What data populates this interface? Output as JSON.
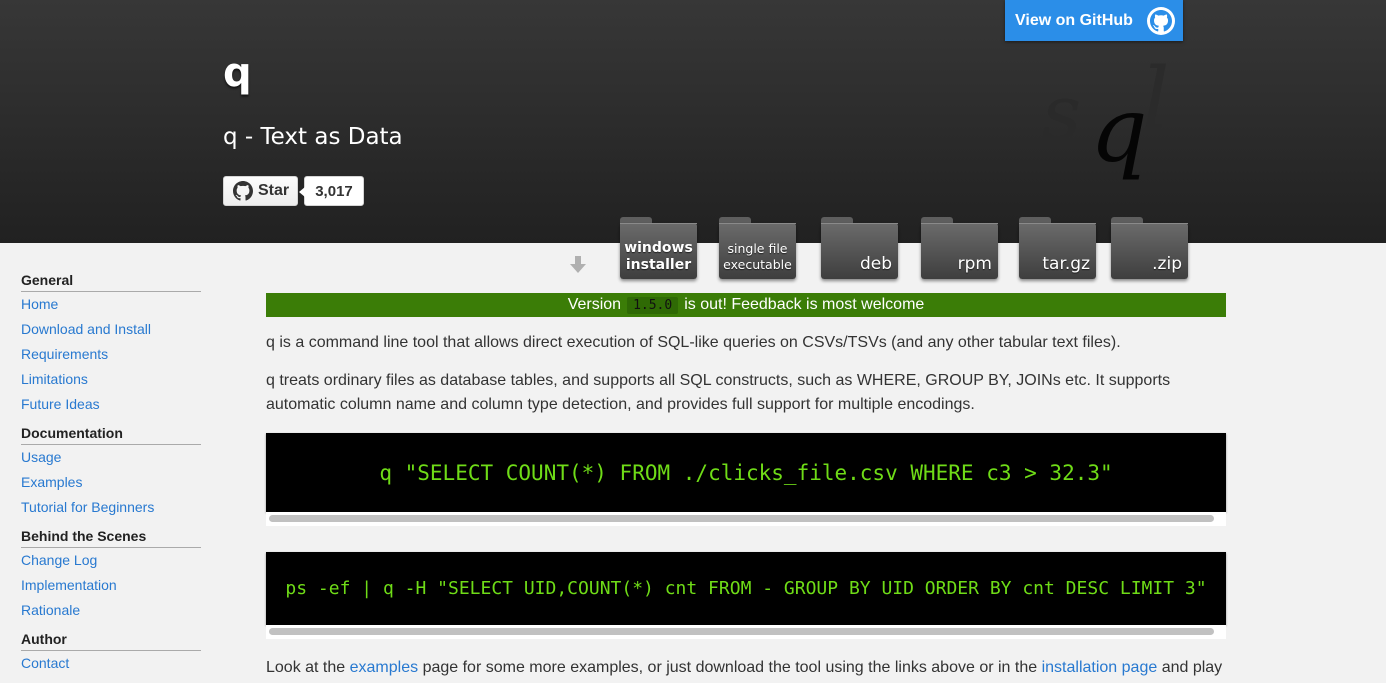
{
  "header": {
    "title": "q",
    "subtitle": "q - Text as Data",
    "star_label": "Star",
    "star_count": "3,017",
    "github_button": "View on GitHub",
    "logo_text": {
      "s": "s",
      "q": "q",
      "l": "l"
    }
  },
  "downloads": [
    {
      "line1": "windows",
      "line2": "installer"
    },
    {
      "line1": "single file",
      "line2": "executable"
    },
    {
      "label": "deb"
    },
    {
      "label": "rpm"
    },
    {
      "label": "tar.gz"
    },
    {
      "label": ".zip"
    }
  ],
  "sidebar": {
    "sections": [
      {
        "heading": "General",
        "links": [
          "Home",
          "Download and Install",
          "Requirements",
          "Limitations",
          "Future Ideas"
        ]
      },
      {
        "heading": "Documentation",
        "links": [
          "Usage",
          "Examples",
          "Tutorial for Beginners"
        ]
      },
      {
        "heading": "Behind the Scenes",
        "links": [
          "Change Log",
          "Implementation",
          "Rationale"
        ]
      },
      {
        "heading": "Author",
        "links": [
          "Contact"
        ]
      }
    ]
  },
  "main": {
    "banner": {
      "before": "Version",
      "version": "1.5.0",
      "after": "is out! Feedback is most welcome"
    },
    "intro1": "q is a command line tool that allows direct execution of SQL-like queries on CSVs/TSVs (and any other tabular text files).",
    "intro2": "q treats ordinary files as database tables, and supports all SQL constructs, such as WHERE, GROUP BY, JOINs etc. It supports automatic column name and column type detection, and provides full support for multiple encodings.",
    "code1": "q \"SELECT COUNT(*) FROM ./clicks_file.csv WHERE c3 > 32.3\"",
    "code2": "ps -ef | q -H \"SELECT UID,COUNT(*) cnt FROM - GROUP BY UID ORDER BY cnt DESC LIMIT 3\"",
    "outro": {
      "part1": "Look at the",
      "link1": "examples",
      "part2": "page for some more examples, or just download the tool using the links above or in the",
      "link2": "installation page",
      "part3": "and play"
    }
  },
  "colors": {
    "link": "#2879d0",
    "banner": "#3b7d07",
    "code_text": "#6fdc17",
    "github_button": "#2b8ee8"
  }
}
